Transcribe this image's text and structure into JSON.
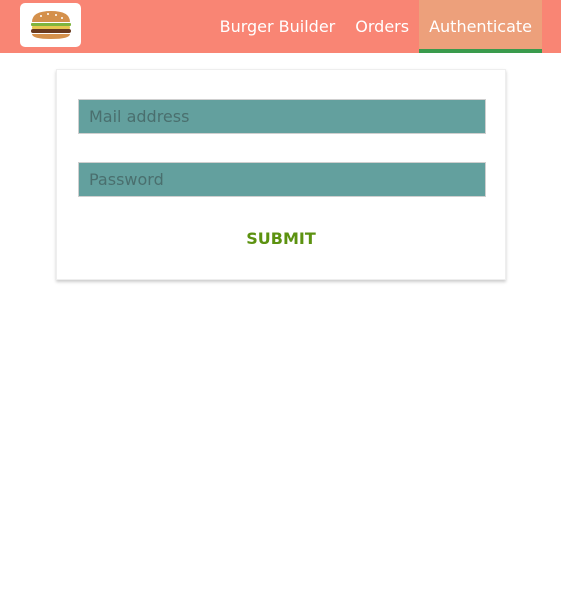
{
  "header": {
    "logo_icon": "burger-icon",
    "nav_items": [
      {
        "label": "Burger Builder",
        "active": false
      },
      {
        "label": "Orders",
        "active": false
      },
      {
        "label": "Authenticate",
        "active": true
      }
    ]
  },
  "auth_form": {
    "email_placeholder": "Mail address",
    "email_value": "",
    "password_placeholder": "Password",
    "password_value": "",
    "submit_label": "SUBMIT"
  },
  "colors": {
    "toolbar_bg": "#F98574",
    "active_nav_bg": "#EDA07B",
    "active_nav_indicator": "#3A9B4D",
    "input_bg": "#63A09E",
    "submit_text": "#5C9210"
  }
}
